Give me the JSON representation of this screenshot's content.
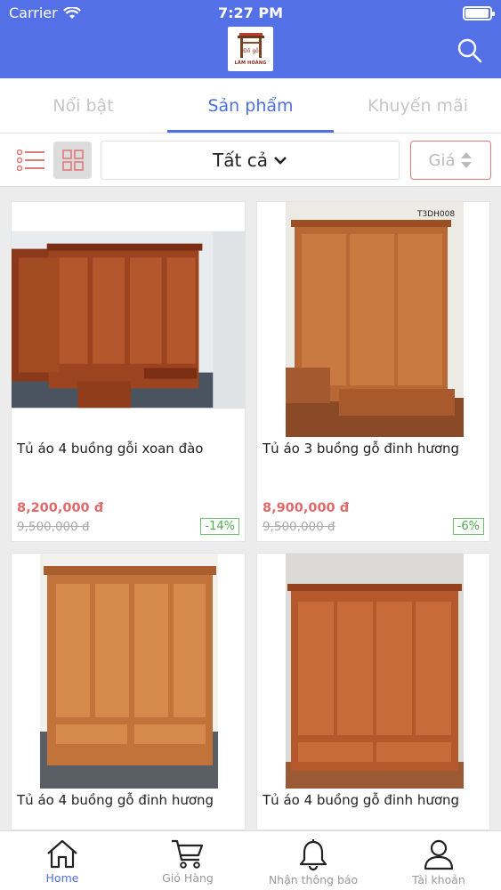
{
  "status_bar": {
    "carrier": "Carrier",
    "time": "7:27 PM",
    "battery_level": 0.95
  },
  "header": {
    "logo_text": "LÂM HOÀNG"
  },
  "tabs": [
    {
      "label": "Nổi bật",
      "active": false
    },
    {
      "label": "Sản phẩm",
      "active": true
    },
    {
      "label": "Khuyến mãi",
      "active": false
    }
  ],
  "filter": {
    "category": "Tất cả",
    "price_label": "Giá"
  },
  "products": [
    {
      "title": "Tủ áo 4 buồng gỗi xoan đào",
      "price": "8,200,000 đ",
      "old_price": "9,500,000 đ",
      "discount": "-14%"
    },
    {
      "title": "Tủ áo 3 buồng gỗ đinh hương",
      "price": "8,900,000 đ",
      "old_price": "9,500,000 đ",
      "discount": "-6%",
      "image_code": "T3DH008"
    },
    {
      "title": "Tủ áo 4 buồng gỗ đinh hương"
    },
    {
      "title": "Tủ áo 4 buồng gỗ đinh hương"
    }
  ],
  "bottom_nav": [
    {
      "label": "Home",
      "icon": "home-icon",
      "active": true
    },
    {
      "label": "Giỏ Hàng",
      "icon": "cart-icon",
      "active": false
    },
    {
      "label": "Nhận thông báo",
      "icon": "bell-icon",
      "active": false
    },
    {
      "label": "Tài khoản",
      "icon": "user-icon",
      "active": false
    }
  ],
  "colors": {
    "brand": "#5470e6",
    "accent": "#4d6fe0",
    "price": "#e06a6a",
    "discount": "#4eaa4e"
  }
}
